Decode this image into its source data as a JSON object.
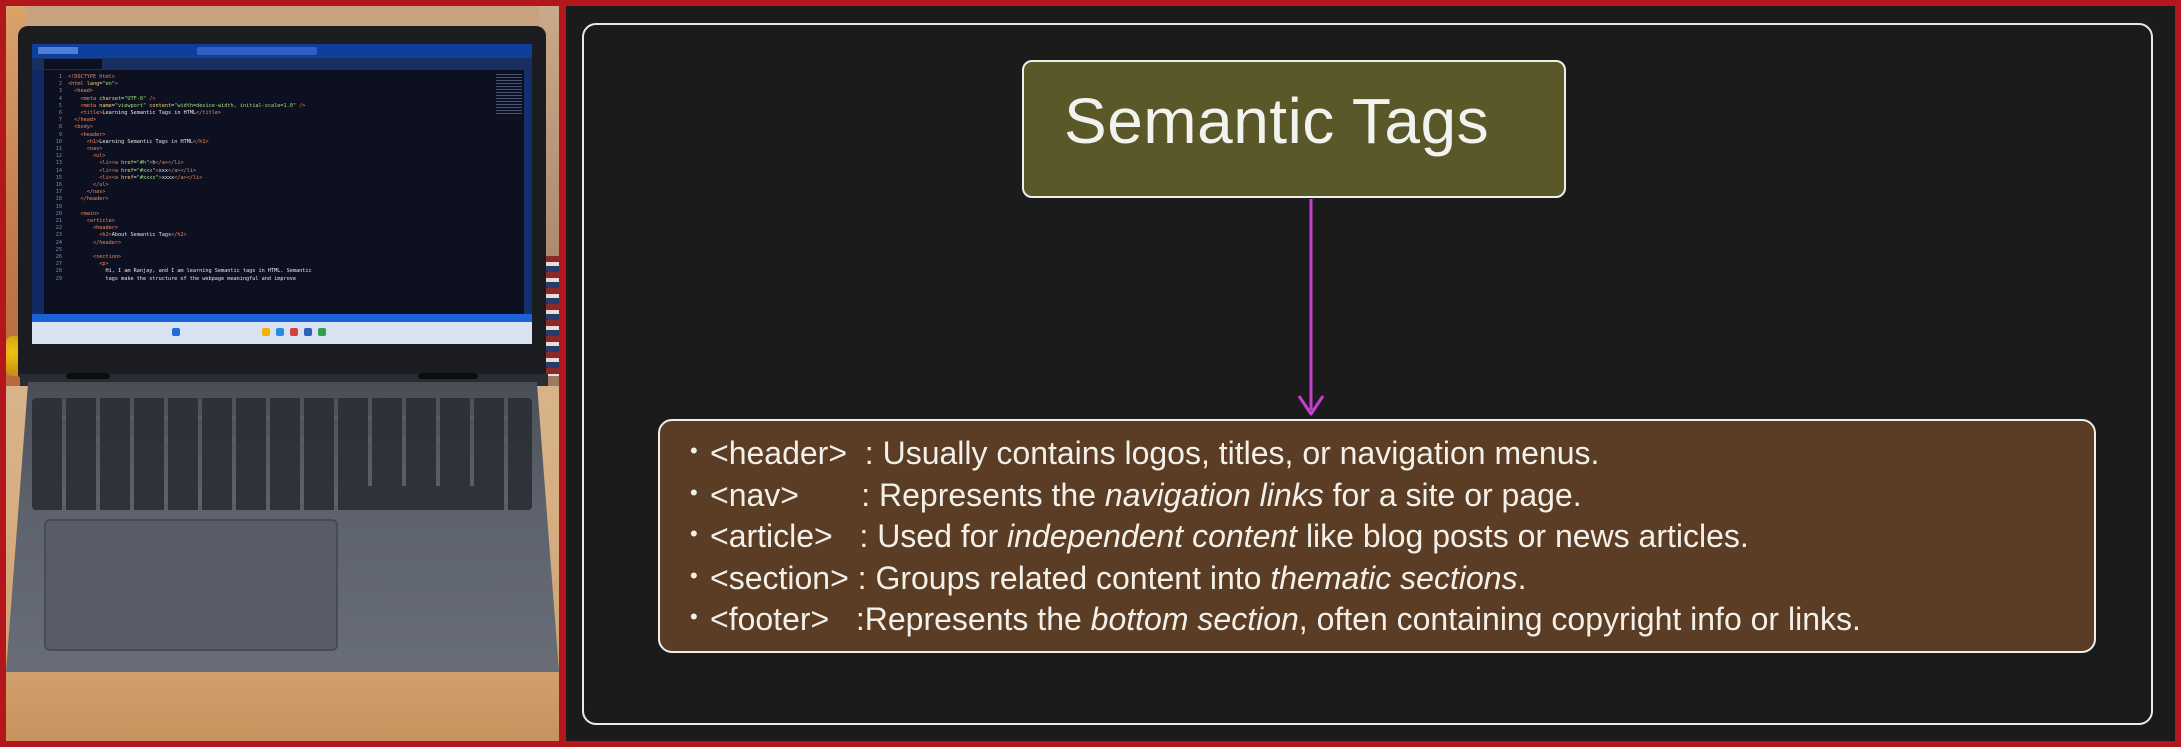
{
  "photo": {
    "code_lines": [
      {
        "n": "1",
        "html": "<span class='t'>&lt;!DOCTYPE html&gt;</span>"
      },
      {
        "n": "2",
        "html": "<span class='t'>&lt;html</span> <span class='a'>lang</span>=<span class='s'>\"en\"</span><span class='t'>&gt;</span>"
      },
      {
        "n": "3",
        "html": "  <span class='t'>&lt;head&gt;</span>"
      },
      {
        "n": "4",
        "html": "    <span class='t'>&lt;meta</span> <span class='a'>charset</span>=<span class='s'>\"UTF-8\"</span> <span class='t'>/&gt;</span>"
      },
      {
        "n": "5",
        "html": "    <span class='t'>&lt;meta</span> <span class='a'>name</span>=<span class='s'>\"viewport\"</span> <span class='a'>content</span>=<span class='s'>\"width=device-width, initial-scale=1.0\"</span> <span class='t'>/&gt;</span>"
      },
      {
        "n": "6",
        "html": "    <span class='t'>&lt;title&gt;</span>Learning Semantic Tags in HTML<span class='t'>&lt;/title&gt;</span>"
      },
      {
        "n": "7",
        "html": "  <span class='t'>&lt;/head&gt;</span>"
      },
      {
        "n": "8",
        "html": "  <span class='t'>&lt;body&gt;</span>"
      },
      {
        "n": "9",
        "html": "    <span class='t'>&lt;header&gt;</span>"
      },
      {
        "n": "10",
        "html": "      <span class='t'>&lt;h1&gt;</span>Learning Semantic Tags in HTML<span class='t'>&lt;/h1&gt;</span>"
      },
      {
        "n": "11",
        "html": "      <span class='t'>&lt;nav&gt;</span>"
      },
      {
        "n": "12",
        "html": "        <span class='t'>&lt;ul&gt;</span>"
      },
      {
        "n": "13",
        "html": "          <span class='t'>&lt;li&gt;&lt;a</span> <span class='a'>href</span>=<span class='s'>\"#h\"</span><span class='t'>&gt;</span>h<span class='t'>&lt;/a&gt;&lt;/li&gt;</span>"
      },
      {
        "n": "14",
        "html": "          <span class='t'>&lt;li&gt;&lt;a</span> <span class='a'>href</span>=<span class='s'>\"#xxx\"</span><span class='t'>&gt;</span>xxx<span class='t'>&lt;/a&gt;&lt;/li&gt;</span>"
      },
      {
        "n": "15",
        "html": "          <span class='t'>&lt;li&gt;&lt;a</span> <span class='a'>href</span>=<span class='s'>\"#xxxx\"</span><span class='t'>&gt;</span>xxxx<span class='t'>&lt;/a&gt;&lt;/li&gt;</span>"
      },
      {
        "n": "16",
        "html": "        <span class='t'>&lt;/ul&gt;</span>"
      },
      {
        "n": "17",
        "html": "      <span class='t'>&lt;/nav&gt;</span>"
      },
      {
        "n": "18",
        "html": "    <span class='t'>&lt;/header&gt;</span>"
      },
      {
        "n": "19",
        "html": ""
      },
      {
        "n": "20",
        "html": "    <span class='t'>&lt;main&gt;</span>"
      },
      {
        "n": "21",
        "html": "      <span class='t'>&lt;article&gt;</span>"
      },
      {
        "n": "22",
        "html": "        <span class='t'>&lt;header&gt;</span>"
      },
      {
        "n": "23",
        "html": "          <span class='t'>&lt;h2&gt;</span>About Semantic Tags<span class='t'>&lt;/h2&gt;</span>"
      },
      {
        "n": "24",
        "html": "        <span class='t'>&lt;/header&gt;</span>"
      },
      {
        "n": "25",
        "html": ""
      },
      {
        "n": "26",
        "html": "        <span class='t'>&lt;section&gt;</span>"
      },
      {
        "n": "27",
        "html": "          <span class='t'>&lt;p&gt;</span>"
      },
      {
        "n": "28",
        "html": "            Hi, I am Ranjay, and I am learning Semantic tags in HTML. Semantic"
      },
      {
        "n": "29",
        "html": "            tags make the structure of the webpage meaningful and improve"
      }
    ]
  },
  "diagram": {
    "title": "Semantic Tags",
    "items": [
      {
        "bullet": "•",
        "tag": "<header>",
        "sep": "  : ",
        "parts": [
          {
            "text": "Usually contains logos, titles, or navigation menus.",
            "italic": false
          }
        ]
      },
      {
        "bullet": "•",
        "tag": "<nav>",
        "sep": "       : ",
        "parts": [
          {
            "text": "Represents the ",
            "italic": false
          },
          {
            "text": "navigation links",
            "italic": true
          },
          {
            "text": " for a site or page.",
            "italic": false
          }
        ]
      },
      {
        "bullet": "•",
        "tag": "<article>",
        "sep": "   : ",
        "parts": [
          {
            "text": "Used for ",
            "italic": false
          },
          {
            "text": "independent content",
            "italic": true
          },
          {
            "text": " like blog posts or news articles.",
            "italic": false
          }
        ]
      },
      {
        "bullet": "•",
        "tag": "<section>",
        "sep": " : ",
        "parts": [
          {
            "text": "Groups related content into ",
            "italic": false
          },
          {
            "text": "thematic sections",
            "italic": true
          },
          {
            "text": ".",
            "italic": false
          }
        ]
      },
      {
        "bullet": "•",
        "tag": "<footer>",
        "sep": "   :",
        "parts": [
          {
            "text": "Represents the ",
            "italic": false
          },
          {
            "text": "bottom section",
            "italic": true
          },
          {
            "text": ", often containing copyright info or links.",
            "italic": false
          }
        ]
      }
    ],
    "colors": {
      "title_box": "#5a5828",
      "list_box": "#5b3c24",
      "arrow": "#c63fd0",
      "background": "#1b1b1b"
    }
  }
}
